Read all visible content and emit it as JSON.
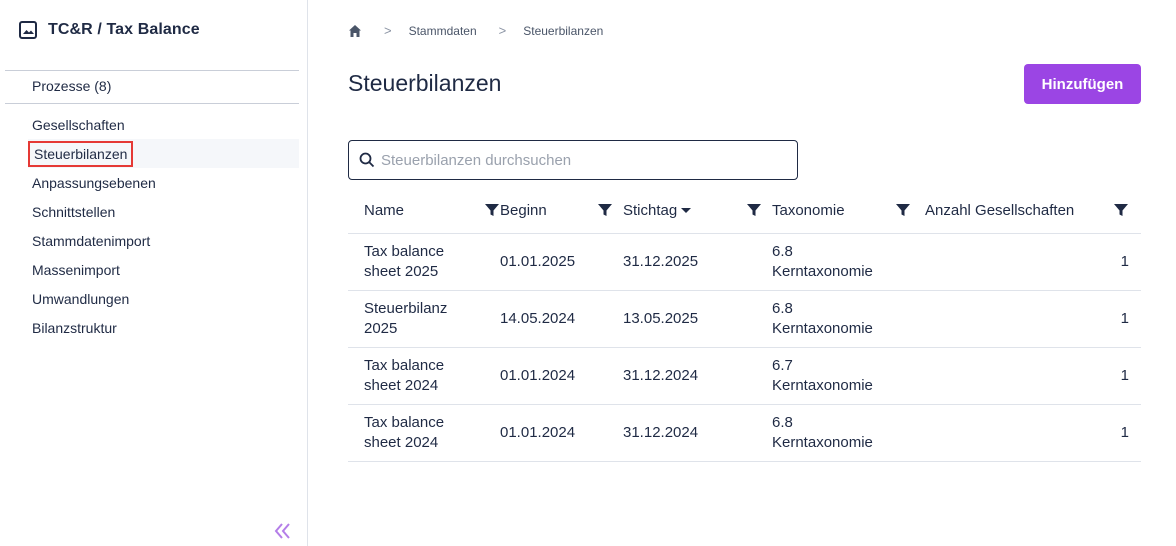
{
  "app": {
    "title": "TC&R / Tax Balance",
    "icon": "image-icon"
  },
  "sidebar": {
    "processes_label": "Prozesse (8)",
    "items": [
      {
        "label": "Gesellschaften",
        "active": false
      },
      {
        "label": "Steuerbilanzen",
        "active": true
      },
      {
        "label": "Anpassungsebenen",
        "active": false
      },
      {
        "label": "Schnittstellen",
        "active": false
      },
      {
        "label": "Stammdatenimport",
        "active": false
      },
      {
        "label": "Massenimport",
        "active": false
      },
      {
        "label": "Umwandlungen",
        "active": false
      },
      {
        "label": "Bilanzstruktur",
        "active": false
      }
    ],
    "collapse_icon": "double-chevron-left-icon"
  },
  "breadcrumb": {
    "items": [
      "Stammdaten",
      "Steuerbilanzen"
    ],
    "sep": ">"
  },
  "page": {
    "title": "Steuerbilanzen",
    "add_button": "Hinzufügen"
  },
  "search": {
    "placeholder": "Steuerbilanzen durchsuchen",
    "value": ""
  },
  "table": {
    "columns": [
      "Name",
      "Beginn",
      "Stichtag",
      "Taxonomie",
      "Anzahl Gesellschaften"
    ],
    "rows": [
      {
        "name_l1": "Tax balance",
        "name_l2": "sheet 2025",
        "beginn": "01.01.2025",
        "stichtag": "31.12.2025",
        "tax_l1": "6.8",
        "tax_l2": "Kerntaxonomie",
        "anzahl": "1"
      },
      {
        "name_l1": "Steuerbilanz",
        "name_l2": "2025",
        "beginn": "14.05.2024",
        "stichtag": "13.05.2025",
        "tax_l1": "6.8",
        "tax_l2": "Kerntaxonomie",
        "anzahl": "1"
      },
      {
        "name_l1": "Tax balance",
        "name_l2": "sheet 2024",
        "beginn": "01.01.2024",
        "stichtag": "31.12.2024",
        "tax_l1": "6.7",
        "tax_l2": "Kerntaxonomie",
        "anzahl": "1"
      },
      {
        "name_l1": "Tax balance",
        "name_l2": "sheet 2024",
        "beginn": "01.01.2024",
        "stichtag": "31.12.2024",
        "tax_l1": "6.8",
        "tax_l2": "Kerntaxonomie",
        "anzahl": "1"
      }
    ]
  },
  "colors": {
    "accent": "#9b45e4",
    "text": "#1f2a44",
    "highlight": "#e53935"
  }
}
